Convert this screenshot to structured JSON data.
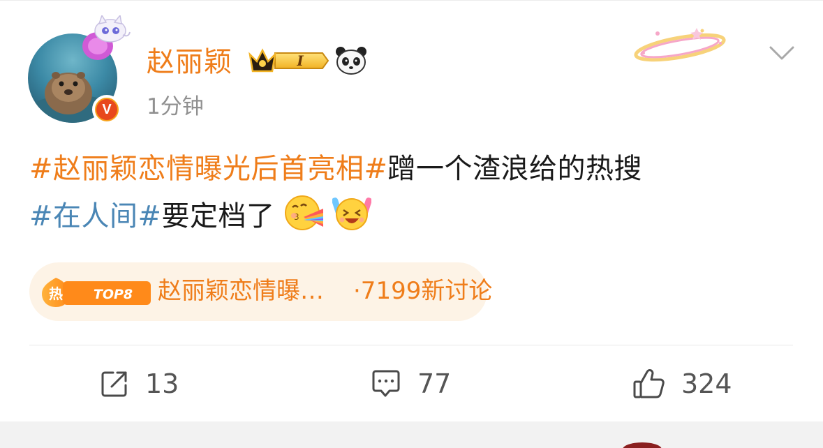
{
  "post": {
    "author": {
      "name": "赵丽颖",
      "verified_mark": "V",
      "level_badge_text": "I"
    },
    "timestamp": "1分钟",
    "content": {
      "line1": {
        "hashtag": "#赵丽颖恋情曝光后首亮相#",
        "text": "蹭一个渣浪给的热搜"
      },
      "line2": {
        "hashtag": "#在人间#",
        "text": "要定档了"
      },
      "emojis": [
        "rainbow-vomit-emoji",
        "excited-laugh-emoji"
      ]
    },
    "hot_topic": {
      "hot_label": "热",
      "rank_label": "TOP8",
      "title": "赵丽颖恋情曝…",
      "count": "·7199新讨论"
    },
    "actions": {
      "share_count": "13",
      "comment_count": "77",
      "like_count": "324"
    }
  },
  "icons": {
    "share": "share-icon",
    "comment": "comment-icon",
    "like": "thumbs-up-icon",
    "menu": "chevron-down-icon"
  },
  "colors": {
    "accent_orange": "#ef7d1a",
    "hashtag_blue": "#4a86b5",
    "pill_bg": "#fdf3e6",
    "muted_gray": "#909090"
  }
}
